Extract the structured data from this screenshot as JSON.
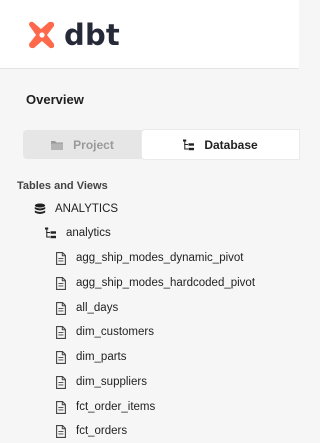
{
  "header": {
    "logo_text": "dbt",
    "logo_color": "#ff694b"
  },
  "sidebar": {
    "overview_title": "Overview",
    "switcher": {
      "project_label": "Project",
      "database_label": "Database",
      "selected": "Database"
    },
    "section_title": "Tables and Views",
    "database": {
      "name": "ANALYTICS",
      "icon": "database-icon"
    },
    "schema": {
      "name": "analytics",
      "icon": "schema-tree-icon"
    },
    "tables": [
      "agg_ship_modes_dynamic_pivot",
      "agg_ship_modes_hardcoded_pivot",
      "all_days",
      "dim_customers",
      "dim_parts",
      "dim_suppliers",
      "fct_order_items",
      "fct_orders"
    ],
    "table_icon": "document-icon"
  }
}
